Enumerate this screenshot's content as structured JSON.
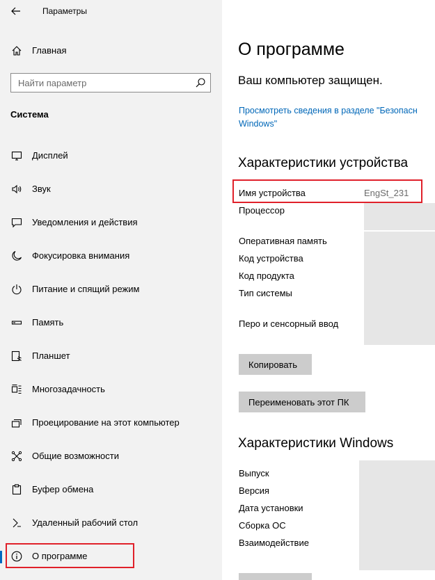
{
  "app": {
    "title": "Параметры"
  },
  "home": {
    "label": "Главная"
  },
  "search": {
    "placeholder": "Найти параметр"
  },
  "section": {
    "title": "Система"
  },
  "nav": {
    "items": [
      {
        "label": "Дисплей",
        "icon": "display-icon"
      },
      {
        "label": "Звук",
        "icon": "speaker-icon"
      },
      {
        "label": "Уведомления и действия",
        "icon": "notification-icon"
      },
      {
        "label": "Фокусировка внимания",
        "icon": "moon-icon"
      },
      {
        "label": "Питание и спящий режим",
        "icon": "power-icon"
      },
      {
        "label": "Память",
        "icon": "storage-icon"
      },
      {
        "label": "Планшет",
        "icon": "tablet-icon"
      },
      {
        "label": "Многозадачность",
        "icon": "multitasking-icon"
      },
      {
        "label": "Проецирование на этот компьютер",
        "icon": "projection-icon"
      },
      {
        "label": "Общие возможности",
        "icon": "shared-experiences-icon"
      },
      {
        "label": "Буфер обмена",
        "icon": "clipboard-icon"
      },
      {
        "label": "Удаленный рабочий стол",
        "icon": "remote-desktop-icon"
      },
      {
        "label": "О программе",
        "icon": "info-icon",
        "selected": true
      }
    ]
  },
  "main": {
    "title": "О программе",
    "protected": "Ваш компьютер защищен.",
    "security_link": "Просмотреть сведения в разделе \"Безопасность Windows\"",
    "security_link_line1": "Просмотреть сведения в разделе \"Безопасн",
    "security_link_line2": "Windows\"",
    "device_heading": "Характеристики устройства",
    "device_specs": [
      {
        "label": "Имя устройства",
        "value": "EngSt_231"
      },
      {
        "label": "Процессор",
        "value": ""
      },
      {
        "label": "Оперативная память",
        "value": ""
      },
      {
        "label": "Код устройства",
        "value": ""
      },
      {
        "label": "Код продукта",
        "value": ""
      },
      {
        "label": "Тип системы",
        "value": ""
      },
      {
        "label": "Перо и сенсорный ввод",
        "value": ""
      }
    ],
    "copy_button": "Копировать",
    "rename_button": "Переименовать этот ПК",
    "windows_heading": "Характеристики Windows",
    "windows_specs": [
      {
        "label": "Выпуск",
        "value": ""
      },
      {
        "label": "Версия",
        "value": ""
      },
      {
        "label": "Дата установки",
        "value": ""
      },
      {
        "label": "Сборка ОС",
        "value": ""
      },
      {
        "label": "Взаимодействие",
        "value": ""
      }
    ]
  },
  "colors": {
    "accent": "#0067c0",
    "link": "#0067b8",
    "highlight": "#e0202a",
    "sidebar_bg": "#f2f2f2"
  }
}
